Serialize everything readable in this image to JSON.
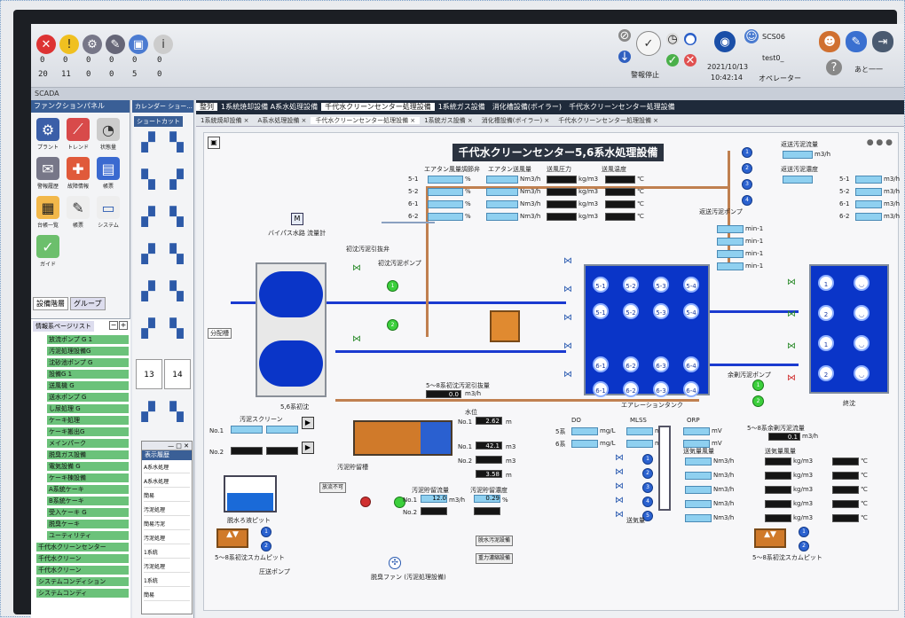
{
  "toolbar": {
    "counts_row1": [
      "0",
      "0",
      "0",
      "0",
      "0",
      "0"
    ],
    "counts_row2": [
      "20",
      "11",
      "0",
      "0",
      "5",
      "0"
    ],
    "date": "2021/10/13",
    "time": "10:42:14",
    "user1": "SCS06",
    "user2": "test0_",
    "operator_label": "オペレーター",
    "status_label": "警報停止",
    "next_label": "あと一一"
  },
  "menubar": {
    "label": "SCADA"
  },
  "left_panel": {
    "header": "ファンクションパネル",
    "icons": [
      {
        "icon": "plant-icon",
        "label": "プラント"
      },
      {
        "icon": "trend-icon",
        "label": "トレンド"
      },
      {
        "icon": "gauge-icon",
        "label": "状態量"
      },
      {
        "icon": "alarm-list-icon",
        "label": "警報履歴"
      },
      {
        "icon": "fault-icon",
        "label": "故障情報"
      },
      {
        "icon": "report-icon",
        "label": "帳票"
      },
      {
        "icon": "ledger-icon",
        "label": "台帳一覧"
      },
      {
        "icon": "manual-icon",
        "label": "帳票"
      },
      {
        "icon": "system-icon",
        "label": "システム"
      },
      {
        "icon": "guide-icon",
        "label": "ガイド"
      }
    ],
    "tabs": [
      "設備階層",
      "グループ"
    ],
    "list_title": "情報系ページリスト",
    "tree_items": [
      "放流ポンプ G 1",
      "汚泥処理設備G",
      "沈砂池ポンプ G",
      "設備G 1",
      "送風機 G",
      "送水ポンプ G",
      "し尿処理 G",
      "ケーキ処理",
      "ケーキ搬出G",
      "メインパーク",
      "脱臭ガス設備",
      "電気設備 G",
      "ケーキ棟設備",
      "A系統ケーキ",
      "B系統ケーキ",
      "受入ケーキ G",
      "脱臭ケーキ",
      "ユーティリティ",
      "千代水クリーンセンター",
      "千代水クリーン",
      "千代水クリーン",
      "システムコンディション",
      "システムコンディ"
    ]
  },
  "short_panel": {
    "header1": "カレンダー",
    "header2": "ショー...",
    "header3": "ショートカット",
    "nums": [
      "13",
      "14"
    ],
    "history_title": "表示履歴",
    "history_items": [
      "A系水処理",
      "A系水処理",
      "簡易",
      "汚泥処理",
      "簡易汚泥",
      "汚泥処理",
      "1系統",
      "汚泥処理",
      "1系統",
      "簡易"
    ]
  },
  "tabs_top": [
    "整列",
    "1系統焼却設備 A系水処理設備",
    "千代水クリーンセンター処理設備",
    "1系統ガス設備",
    "消化槽設備(ボイラー)",
    "千代水クリーンセンター処理設備"
  ],
  "tabs_sub": [
    "1系統焼却設備 ×",
    "A系水処理設備 ×",
    "千代水クリーンセンター処理設備 ×",
    "1系統ガス設備 ×",
    "消化槽設備(ボイラー) ×",
    "千代水クリーンセンター処理設備 ×"
  ],
  "canvas": {
    "title": "千代水クリーンセンター5,6系水処理設備",
    "bypass_label": "バイパス水路 流量計",
    "settle_label": "5,6系初沈",
    "inlet_label": "分配槽",
    "pump1_label": "初沈汚泥引抜弁",
    "pump2_label": "初沈汚泥ポンプ",
    "aeration_label": "エアレーションタンク",
    "final_label": "終沈",
    "ret_pump_label": "返送汚泥ポンプ",
    "blower_label": "送気量",
    "excess_label": "余剰汚泥ポンプ",
    "screen_label": "汚泥スクリーン",
    "pit_label": "脱水ろ液ピット",
    "thick_label": "汚泥貯留槽",
    "fan_label": "脱臭ファン (汚泥処理設備)",
    "flow_label": "5〜8系初沈汚泥引抜量",
    "flow_value": "0.0",
    "unit_m3h": "m3/h",
    "air_head": [
      "エアタン風量調節弁",
      "エアタン送風量",
      "送風圧力",
      "送風温度"
    ],
    "air_rows": [
      "5-1",
      "5-2",
      "6-1",
      "6-2"
    ],
    "unit_pct": "%",
    "unit_nm": "Nm3/h",
    "unit_kg": "kg/m3",
    "unit_c": "℃",
    "return_head": [
      "返送汚泥流量",
      "返送汚泥濃度"
    ],
    "return_rows": [
      "5-1",
      "5-2",
      "6-1",
      "6-2"
    ],
    "unit_min": "min-1",
    "do_head": [
      "DO",
      "MLSS",
      "ORP"
    ],
    "do_rows": [
      "5系",
      "6系"
    ],
    "unit_mgl": "mg/L",
    "unit_mv": "mV",
    "level_head": "水位",
    "level_rows": [
      "No.1",
      "No.2"
    ],
    "level_vals": [
      "2.62",
      "42.1",
      "3.58"
    ],
    "unit_m": "m",
    "unit_m3": "m3",
    "sludge_head": [
      "汚泥貯留流量",
      "汚泥貯留濃度"
    ],
    "sludge_val1": "12.0",
    "sludge_val2": "0.29",
    "unit_pct2": "%",
    "final_pump_label": "5〜8系初沈スカムピット",
    "excess_flow_label": "5〜8系余剰汚泥流量",
    "excess_flow_val": "0.1",
    "press_label": "圧送ポンプ",
    "btn1": "脱水汚泥設備",
    "btn2": "重力濃縮設備",
    "btn3": "放流不可",
    "b_head": [
      "送気量風量",
      "送気量風量"
    ]
  }
}
